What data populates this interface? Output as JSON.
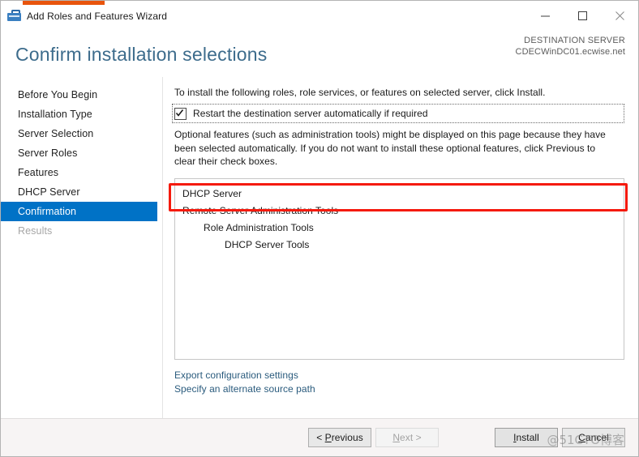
{
  "window": {
    "title": "Add Roles and Features Wizard",
    "icon": "server-tools-icon",
    "accent_color": "#e8540c",
    "controls": {
      "minimize": "minimize-icon",
      "maximize": "maximize-icon",
      "close": "close-icon"
    }
  },
  "header": {
    "page_title": "Confirm installation selections",
    "destination_label": "DESTINATION SERVER",
    "destination_server": "CDECWinDC01.ecwise.net"
  },
  "sidebar": {
    "items": [
      {
        "label": "Before You Begin",
        "state": "normal"
      },
      {
        "label": "Installation Type",
        "state": "normal"
      },
      {
        "label": "Server Selection",
        "state": "normal"
      },
      {
        "label": "Server Roles",
        "state": "normal"
      },
      {
        "label": "Features",
        "state": "normal"
      },
      {
        "label": "DHCP Server",
        "state": "normal"
      },
      {
        "label": "Confirmation",
        "state": "selected"
      },
      {
        "label": "Results",
        "state": "disabled"
      }
    ],
    "selected_color": "#0072c6"
  },
  "content": {
    "intro_text": "To install the following roles, role services, or features on selected server, click Install.",
    "restart_checkbox": {
      "label": "Restart the destination server automatically if required",
      "checked": true
    },
    "optional_text": "Optional features (such as administration tools) might be displayed on this page because they have been selected automatically. If you do not want to install these optional features, click Previous to clear their check boxes.",
    "features": [
      {
        "label": "DHCP Server",
        "level": 0
      },
      {
        "label": "Remote Server Administration Tools",
        "level": 0
      },
      {
        "label": "Role Administration Tools",
        "level": 1
      },
      {
        "label": "DHCP Server Tools",
        "level": 2
      }
    ],
    "links": [
      {
        "label": "Export configuration settings"
      },
      {
        "label": "Specify an alternate source path"
      }
    ]
  },
  "annotation": {
    "color": "#f51a0d",
    "target": "restart-checkbox-row"
  },
  "footer": {
    "previous": {
      "pre": "< ",
      "mnemonic": "P",
      "post": "revious",
      "disabled": false
    },
    "next": {
      "pre": "",
      "mnemonic": "N",
      "post": "ext >",
      "disabled": true
    },
    "install": {
      "pre": "",
      "mnemonic": "I",
      "post": "nstall",
      "disabled": false
    },
    "cancel": {
      "pre": "",
      "mnemonic": "C",
      "post": "ancel",
      "disabled": false
    }
  },
  "watermark": {
    "text": "@51CTO博客"
  }
}
